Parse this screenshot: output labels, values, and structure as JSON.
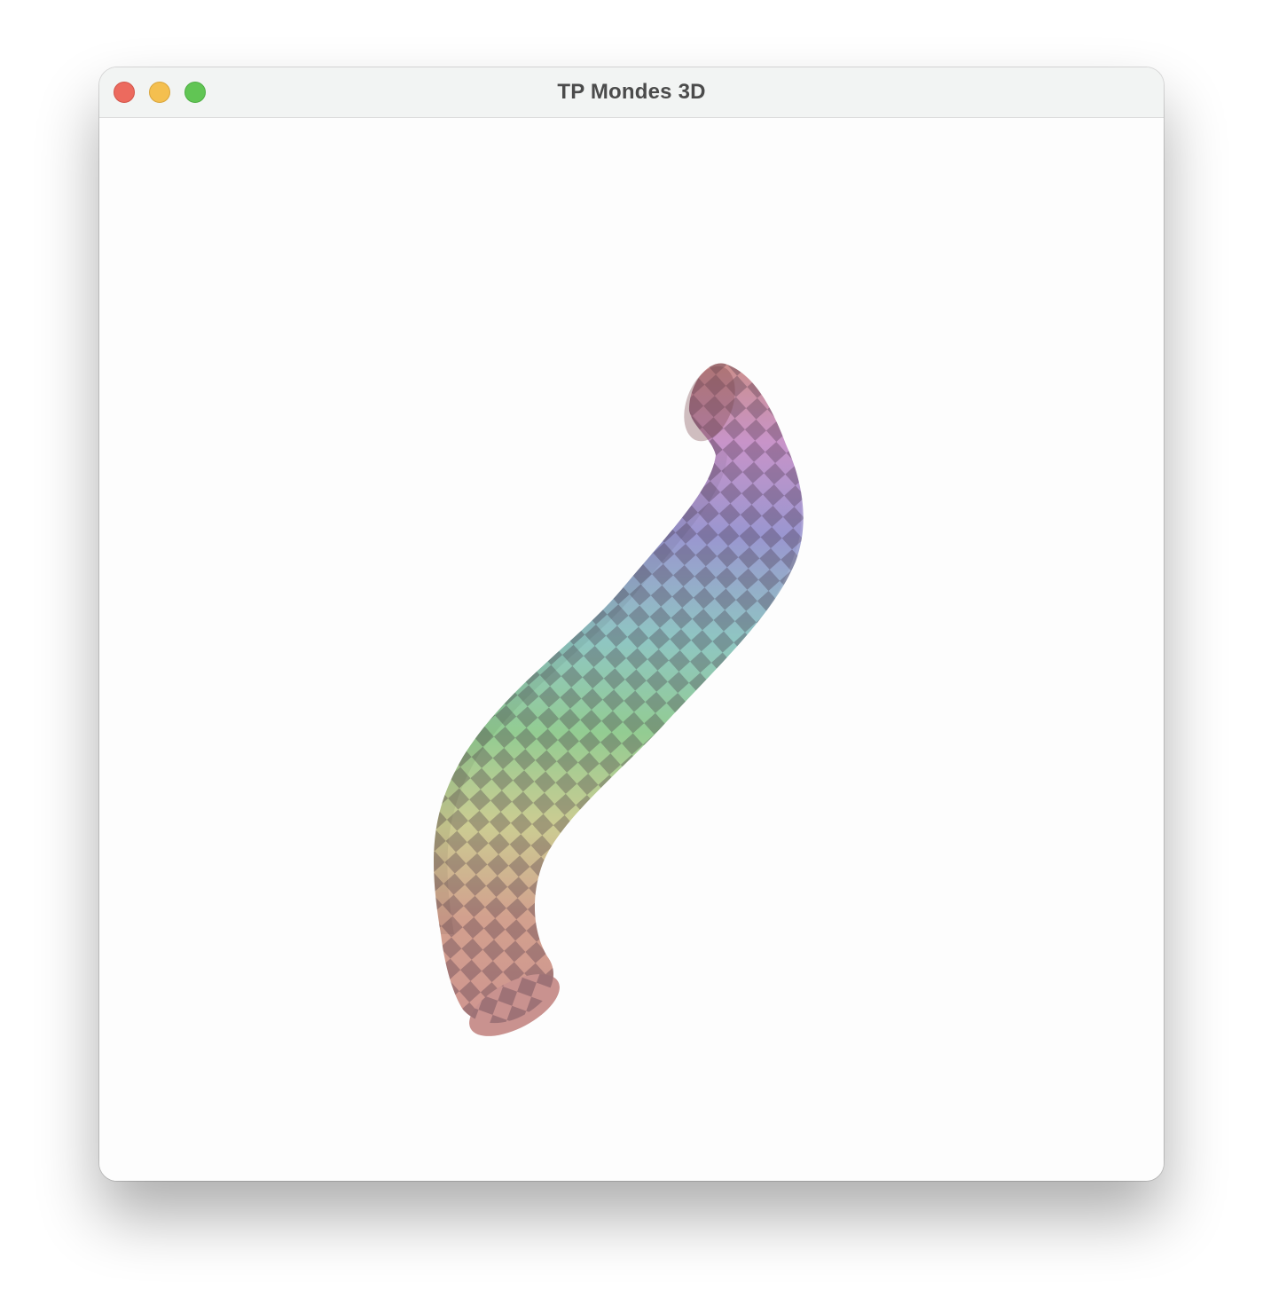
{
  "window": {
    "title": "TP Mondes 3D",
    "controls": {
      "close": "close-button",
      "minimize": "minimize-button",
      "maximize": "zoom-button"
    }
  },
  "scene": {
    "background": "#fdfdfd",
    "object": "checkered-tube",
    "gradient_colors": [
      "#d49a95",
      "#cc92cc",
      "#9c98d0",
      "#92c8c4",
      "#95cc93",
      "#cdcd93",
      "#d49a95"
    ]
  }
}
